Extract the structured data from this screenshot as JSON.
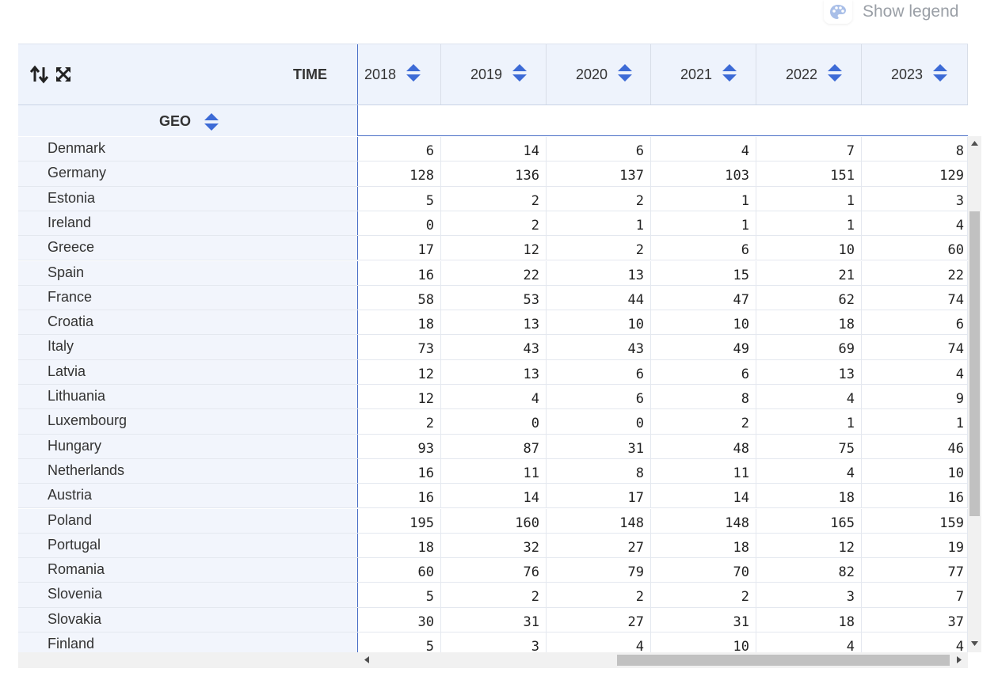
{
  "legend": {
    "label": "Show legend",
    "icon": "palette-icon"
  },
  "header": {
    "time_label": "TIME",
    "geo_label": "GEO",
    "years": [
      "2018",
      "2019",
      "2020",
      "2021",
      "2022",
      "2023"
    ]
  },
  "rows": [
    {
      "geo": "Denmark",
      "values": [
        "6",
        "14",
        "6",
        "4",
        "7",
        "8"
      ]
    },
    {
      "geo": "Germany",
      "values": [
        "128",
        "136",
        "137",
        "103",
        "151",
        "129"
      ]
    },
    {
      "geo": "Estonia",
      "values": [
        "5",
        "2",
        "2",
        "1",
        "1",
        "3"
      ]
    },
    {
      "geo": "Ireland",
      "values": [
        "0",
        "2",
        "1",
        "1",
        "1",
        "4"
      ]
    },
    {
      "geo": "Greece",
      "values": [
        "17",
        "12",
        "2",
        "6",
        "10",
        "60"
      ]
    },
    {
      "geo": "Spain",
      "values": [
        "16",
        "22",
        "13",
        "15",
        "21",
        "22"
      ]
    },
    {
      "geo": "France",
      "values": [
        "58",
        "53",
        "44",
        "47",
        "62",
        "74"
      ]
    },
    {
      "geo": "Croatia",
      "values": [
        "18",
        "13",
        "10",
        "10",
        "18",
        "6"
      ]
    },
    {
      "geo": "Italy",
      "values": [
        "73",
        "43",
        "43",
        "49",
        "69",
        "74"
      ]
    },
    {
      "geo": "Latvia",
      "values": [
        "12",
        "13",
        "6",
        "6",
        "13",
        "4"
      ]
    },
    {
      "geo": "Lithuania",
      "values": [
        "12",
        "4",
        "6",
        "8",
        "4",
        "9"
      ]
    },
    {
      "geo": "Luxembourg",
      "values": [
        "2",
        "0",
        "0",
        "2",
        "1",
        "1"
      ]
    },
    {
      "geo": "Hungary",
      "values": [
        "93",
        "87",
        "31",
        "48",
        "75",
        "46"
      ]
    },
    {
      "geo": "Netherlands",
      "values": [
        "16",
        "11",
        "8",
        "11",
        "4",
        "10"
      ]
    },
    {
      "geo": "Austria",
      "values": [
        "16",
        "14",
        "17",
        "14",
        "18",
        "16"
      ]
    },
    {
      "geo": "Poland",
      "values": [
        "195",
        "160",
        "148",
        "148",
        "165",
        "159"
      ]
    },
    {
      "geo": "Portugal",
      "values": [
        "18",
        "32",
        "27",
        "18",
        "12",
        "19"
      ]
    },
    {
      "geo": "Romania",
      "values": [
        "60",
        "76",
        "79",
        "70",
        "82",
        "77"
      ]
    },
    {
      "geo": "Slovenia",
      "values": [
        "5",
        "2",
        "2",
        "2",
        "3",
        "7"
      ]
    },
    {
      "geo": "Slovakia",
      "values": [
        "30",
        "31",
        "27",
        "31",
        "18",
        "37"
      ]
    },
    {
      "geo": "Finland",
      "values": [
        "5",
        "3",
        "4",
        "10",
        "4",
        "4"
      ]
    }
  ],
  "colors": {
    "accent": "#3d6bd6",
    "header_bg": "#eef3fc",
    "row_label_bg": "#f2f5fc",
    "divider": "#4a6fc7"
  }
}
